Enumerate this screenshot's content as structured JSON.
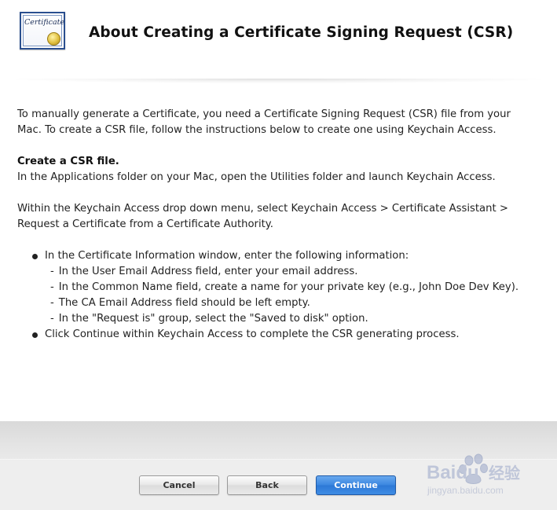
{
  "header": {
    "icon_name": "certificate-icon",
    "icon_script": "Certificate",
    "title": "About Creating a Certificate Signing Request (CSR)"
  },
  "content": {
    "intro_line1": "To manually generate a Certificate, you need a Certificate Signing Request (CSR) file from your",
    "intro_line2": "Mac. To create a CSR file, follow the instructions below to create one using Keychain Access.",
    "section_heading": "Create a CSR file.",
    "section_line": "In the Applications folder on your Mac, open the Utilities folder and launch Keychain Access.",
    "menu_line1": "Within the Keychain Access drop down menu, select Keychain Access > Certificate Assistant >",
    "menu_line2": "Request a Certificate from a Certificate Authority.",
    "bullets": [
      {
        "text": "In the Certificate Information window, enter the following information:",
        "sub": [
          "In the User Email Address field, enter your email address.",
          "In the Common Name field, create a name for your private key (e.g., John Doe Dev Key).",
          "The CA Email Address field should be left empty.",
          "In the \"Request is\" group, select the \"Saved to disk\" option."
        ]
      },
      {
        "text": "Click Continue within Keychain Access to complete the CSR generating process."
      }
    ]
  },
  "footer": {
    "cancel_label": "Cancel",
    "back_label": "Back",
    "continue_label": "Continue",
    "accent_color": "#2c78d6"
  },
  "watermark": {
    "brand": "Baidu",
    "brand_cn": "经验",
    "url": "jingyan.baidu.com"
  }
}
